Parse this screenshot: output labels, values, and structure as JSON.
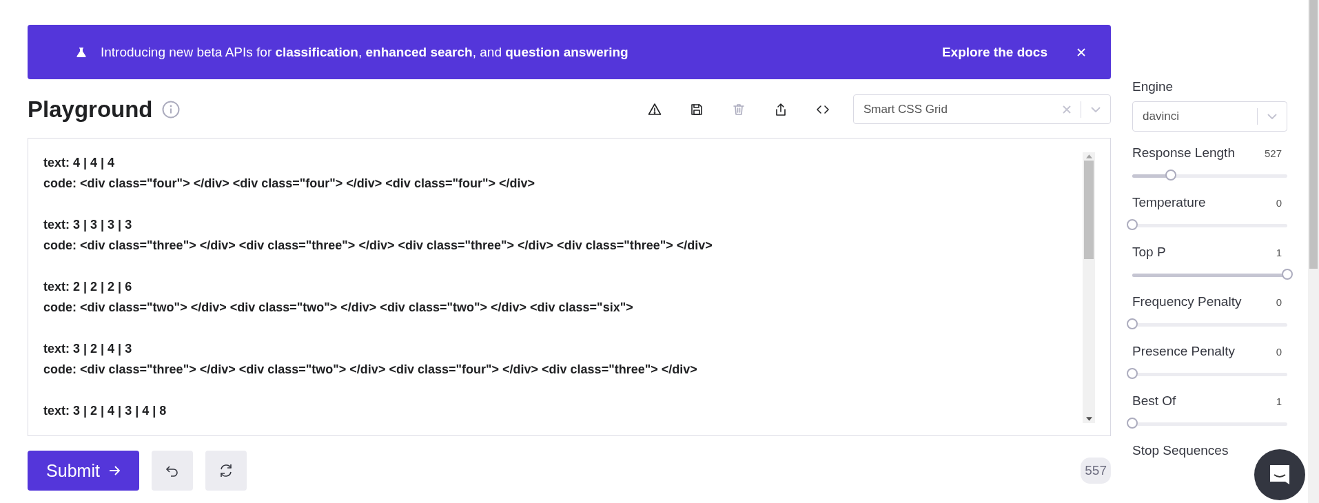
{
  "banner": {
    "message": "Introducing new beta APIs for **classification**, **enhanced search**, and **question answering**",
    "link": "Explore the docs"
  },
  "header": {
    "title": "Playground"
  },
  "toolbar": [
    {
      "kind": "warning",
      "disabled": false
    },
    {
      "kind": "save",
      "disabled": false
    },
    {
      "kind": "delete",
      "disabled": true
    },
    {
      "kind": "share",
      "disabled": false
    },
    {
      "kind": "code",
      "disabled": false
    }
  ],
  "preset_select": {
    "value": "Smart CSS Grid"
  },
  "prompt": [
    [
      "text: 4 | 4 | 4",
      "code: <div class=\"four\"> </div> <div class=\"four\"> </div> <div class=\"four\"> </div>"
    ],
    [
      "text: 3 | 3 | 3 | 3",
      "code: <div class=\"three\"> </div> <div class=\"three\"> </div> <div class=\"three\"> </div> <div class=\"three\"> </div>"
    ],
    [
      "text: 2 | 2 | 2 | 6",
      "code: <div class=\"two\"> </div> <div class=\"two\"> </div> <div class=\"two\"> </div> <div class=\"six\">"
    ],
    [
      "text: 3 | 2 | 4 | 3",
      "code: <div class=\"three\"> </div> <div class=\"two\"> </div> <div class=\"four\"> </div> <div class=\"three\"> </div>"
    ],
    [
      "text: 3 | 2 | 4 | 3 | 4 | 8"
    ]
  ],
  "submit": {
    "label": "Submit"
  },
  "token_count": "557",
  "settings": {
    "engine_label": "Engine",
    "engine": "davinci",
    "sliders": [
      {
        "label": "Response Length",
        "reading": "527",
        "level": 0.25
      },
      {
        "label": "Temperature",
        "reading": "0",
        "level": 0
      },
      {
        "label": "Top P",
        "reading": "1",
        "level": 1
      },
      {
        "label": "Frequency Penalty",
        "reading": "0",
        "level": 0
      },
      {
        "label": "Presence Penalty",
        "reading": "0",
        "level": 0
      },
      {
        "label": "Best Of",
        "reading": "1",
        "level": 0
      }
    ],
    "stop_label": "Stop Sequences"
  }
}
